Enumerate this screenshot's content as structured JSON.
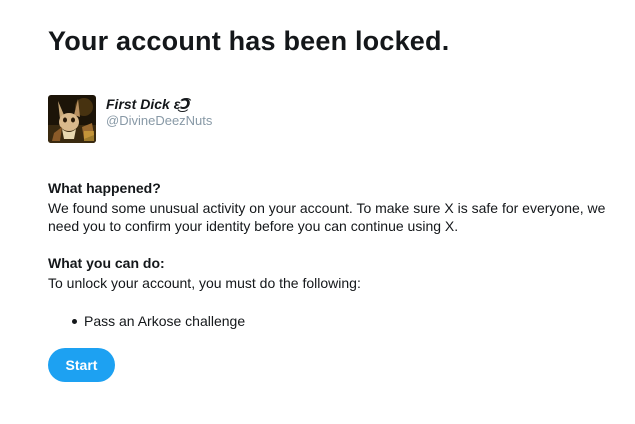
{
  "page": {
    "title": "Your account has been locked."
  },
  "profile": {
    "display_name": "First Dick ε͜͡Ↄ",
    "handle": "@DivineDeezNuts",
    "avatar_icon": "profile-avatar"
  },
  "what_happened": {
    "heading": "What happened?",
    "text": "We found some unusual activity on your account. To make sure X is safe for everyone, we need you to confirm your identity before you can continue using X."
  },
  "what_you_can_do": {
    "heading": "What you can do:",
    "text": "To unlock your account, you must do the following:",
    "steps": [
      "Pass an Arkose challenge"
    ]
  },
  "actions": {
    "start_label": "Start"
  },
  "colors": {
    "accent": "#1da1f2",
    "text": "#14171a",
    "muted": "#8899a6",
    "background": "#ffffff"
  }
}
